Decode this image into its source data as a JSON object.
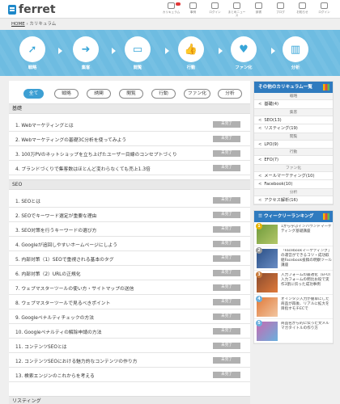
{
  "header": {
    "logo": "ferret",
    "nav": [
      {
        "label": "カリキュラム",
        "icon": "curriculum-icon",
        "badge": true
      },
      {
        "label": "事例",
        "icon": "chart-icon"
      },
      {
        "label": "ログイン",
        "icon": "user-icon"
      },
      {
        "label": "まとめニュース",
        "icon": "news-icon"
      },
      {
        "label": "辞書",
        "icon": "book-icon"
      },
      {
        "label": "ブログ",
        "icon": "blog-icon"
      },
      {
        "label": "お知らせ",
        "icon": "bell-icon"
      },
      {
        "label": "ログイン",
        "icon": "login-icon"
      }
    ]
  },
  "breadcrumb": {
    "home": "HOME",
    "separator": "›",
    "current": "カリキュラム"
  },
  "steps": [
    {
      "label": "戦略",
      "icon": "rocket-icon",
      "glyph": "➚"
    },
    {
      "label": "集客",
      "icon": "enter-icon",
      "glyph": "➜"
    },
    {
      "label": "閲覧",
      "icon": "monitor-icon",
      "glyph": "▭"
    },
    {
      "label": "行動",
      "icon": "thumbs-up-icon",
      "glyph": "👍"
    },
    {
      "label": "ファン化",
      "icon": "heart-icon",
      "glyph": "♥"
    },
    {
      "label": "分析",
      "icon": "bar-chart-icon",
      "glyph": "▥"
    }
  ],
  "filters": [
    "全て",
    "戦略",
    "誘関",
    "閲覧",
    "行動",
    "ファン化",
    "分析"
  ],
  "done_label": "未完了",
  "sections": [
    {
      "title": "基礎",
      "items": [
        "1. Webマーケティングとは",
        "2. Webマーケティングの基礎3C分析を使ってみよう",
        "3. 100万PVのネットショップを立ち上げたユーザー目線のコンセプトづくり",
        "4. ブランドづくりで集客数はほとんど変わらなくても売上1.3倍"
      ]
    },
    {
      "title": "SEO",
      "items": [
        "1. SEOとは",
        "2. SEOでキーワード選定が重要な理由",
        "3. SEO対策を行うキーワードの選び方",
        "4. Googleが追回しやすいホームページにしよう",
        "5. 内部対策（1）SEOで重視される基本のタグ",
        "6. 内部対策（2）URLの正規化",
        "7. ウェブマスターツールの使い方・サイトマップの送信",
        "8. ウェブマスターツールで見るべきポイント",
        "9. Googleペナルティチェックの方法",
        "10. Googleペナルティの解除申請の方法",
        "11. コンテンツSEOとは",
        "12. コンテンツSEOにおける魅力的なコンテンツの作り方",
        "13. 検索エンジンのこれからを考える"
      ]
    },
    {
      "title": "リスティング",
      "items": []
    }
  ],
  "sidebar": {
    "categories_title": "その他のカリキュラム一覧",
    "groups": [
      {
        "header": "戦略",
        "items": [
          "基礎(4)"
        ]
      },
      {
        "header": "集客",
        "items": [
          "SEO(13)",
          "リスティング(19)"
        ]
      },
      {
        "header": "閲覧",
        "items": [
          "LPO(9)"
        ]
      },
      {
        "header": "行動",
        "items": [
          "EFO(7)"
        ]
      },
      {
        "header": "ファン化",
        "items": [
          "メールマーケティング(10)",
          "Facebook(10)"
        ]
      },
      {
        "header": "分析",
        "items": [
          "アクセス解析(16)"
        ]
      }
    ],
    "ranking_title": "ウィークリーランキング",
    "ranking": [
      {
        "num": "1",
        "text": "1から学ぶインバウンドマーケティング基礎講座",
        "color": "#e7b400"
      },
      {
        "num": "2",
        "text": "「Facebookマーケティング」の運営ができるコツ・成功取組Facebook投稿の明察ツール講座",
        "color": "#9a9a9a"
      },
      {
        "num": "3",
        "text": "入力フォームの最適化（EFO）入力フォームの明比お役で実作3割に伝った成功事例",
        "color": "#c97a3a"
      },
      {
        "num": "4",
        "text": "オインタジ入力が簡単にした商品が再後、リアルに拡大を目指すモチECで",
        "color": "#6ab0de"
      },
      {
        "num": "5",
        "text": "商品名から的に伝った文メルマガタイトルの作り方",
        "color": "#6ab0de"
      }
    ]
  }
}
